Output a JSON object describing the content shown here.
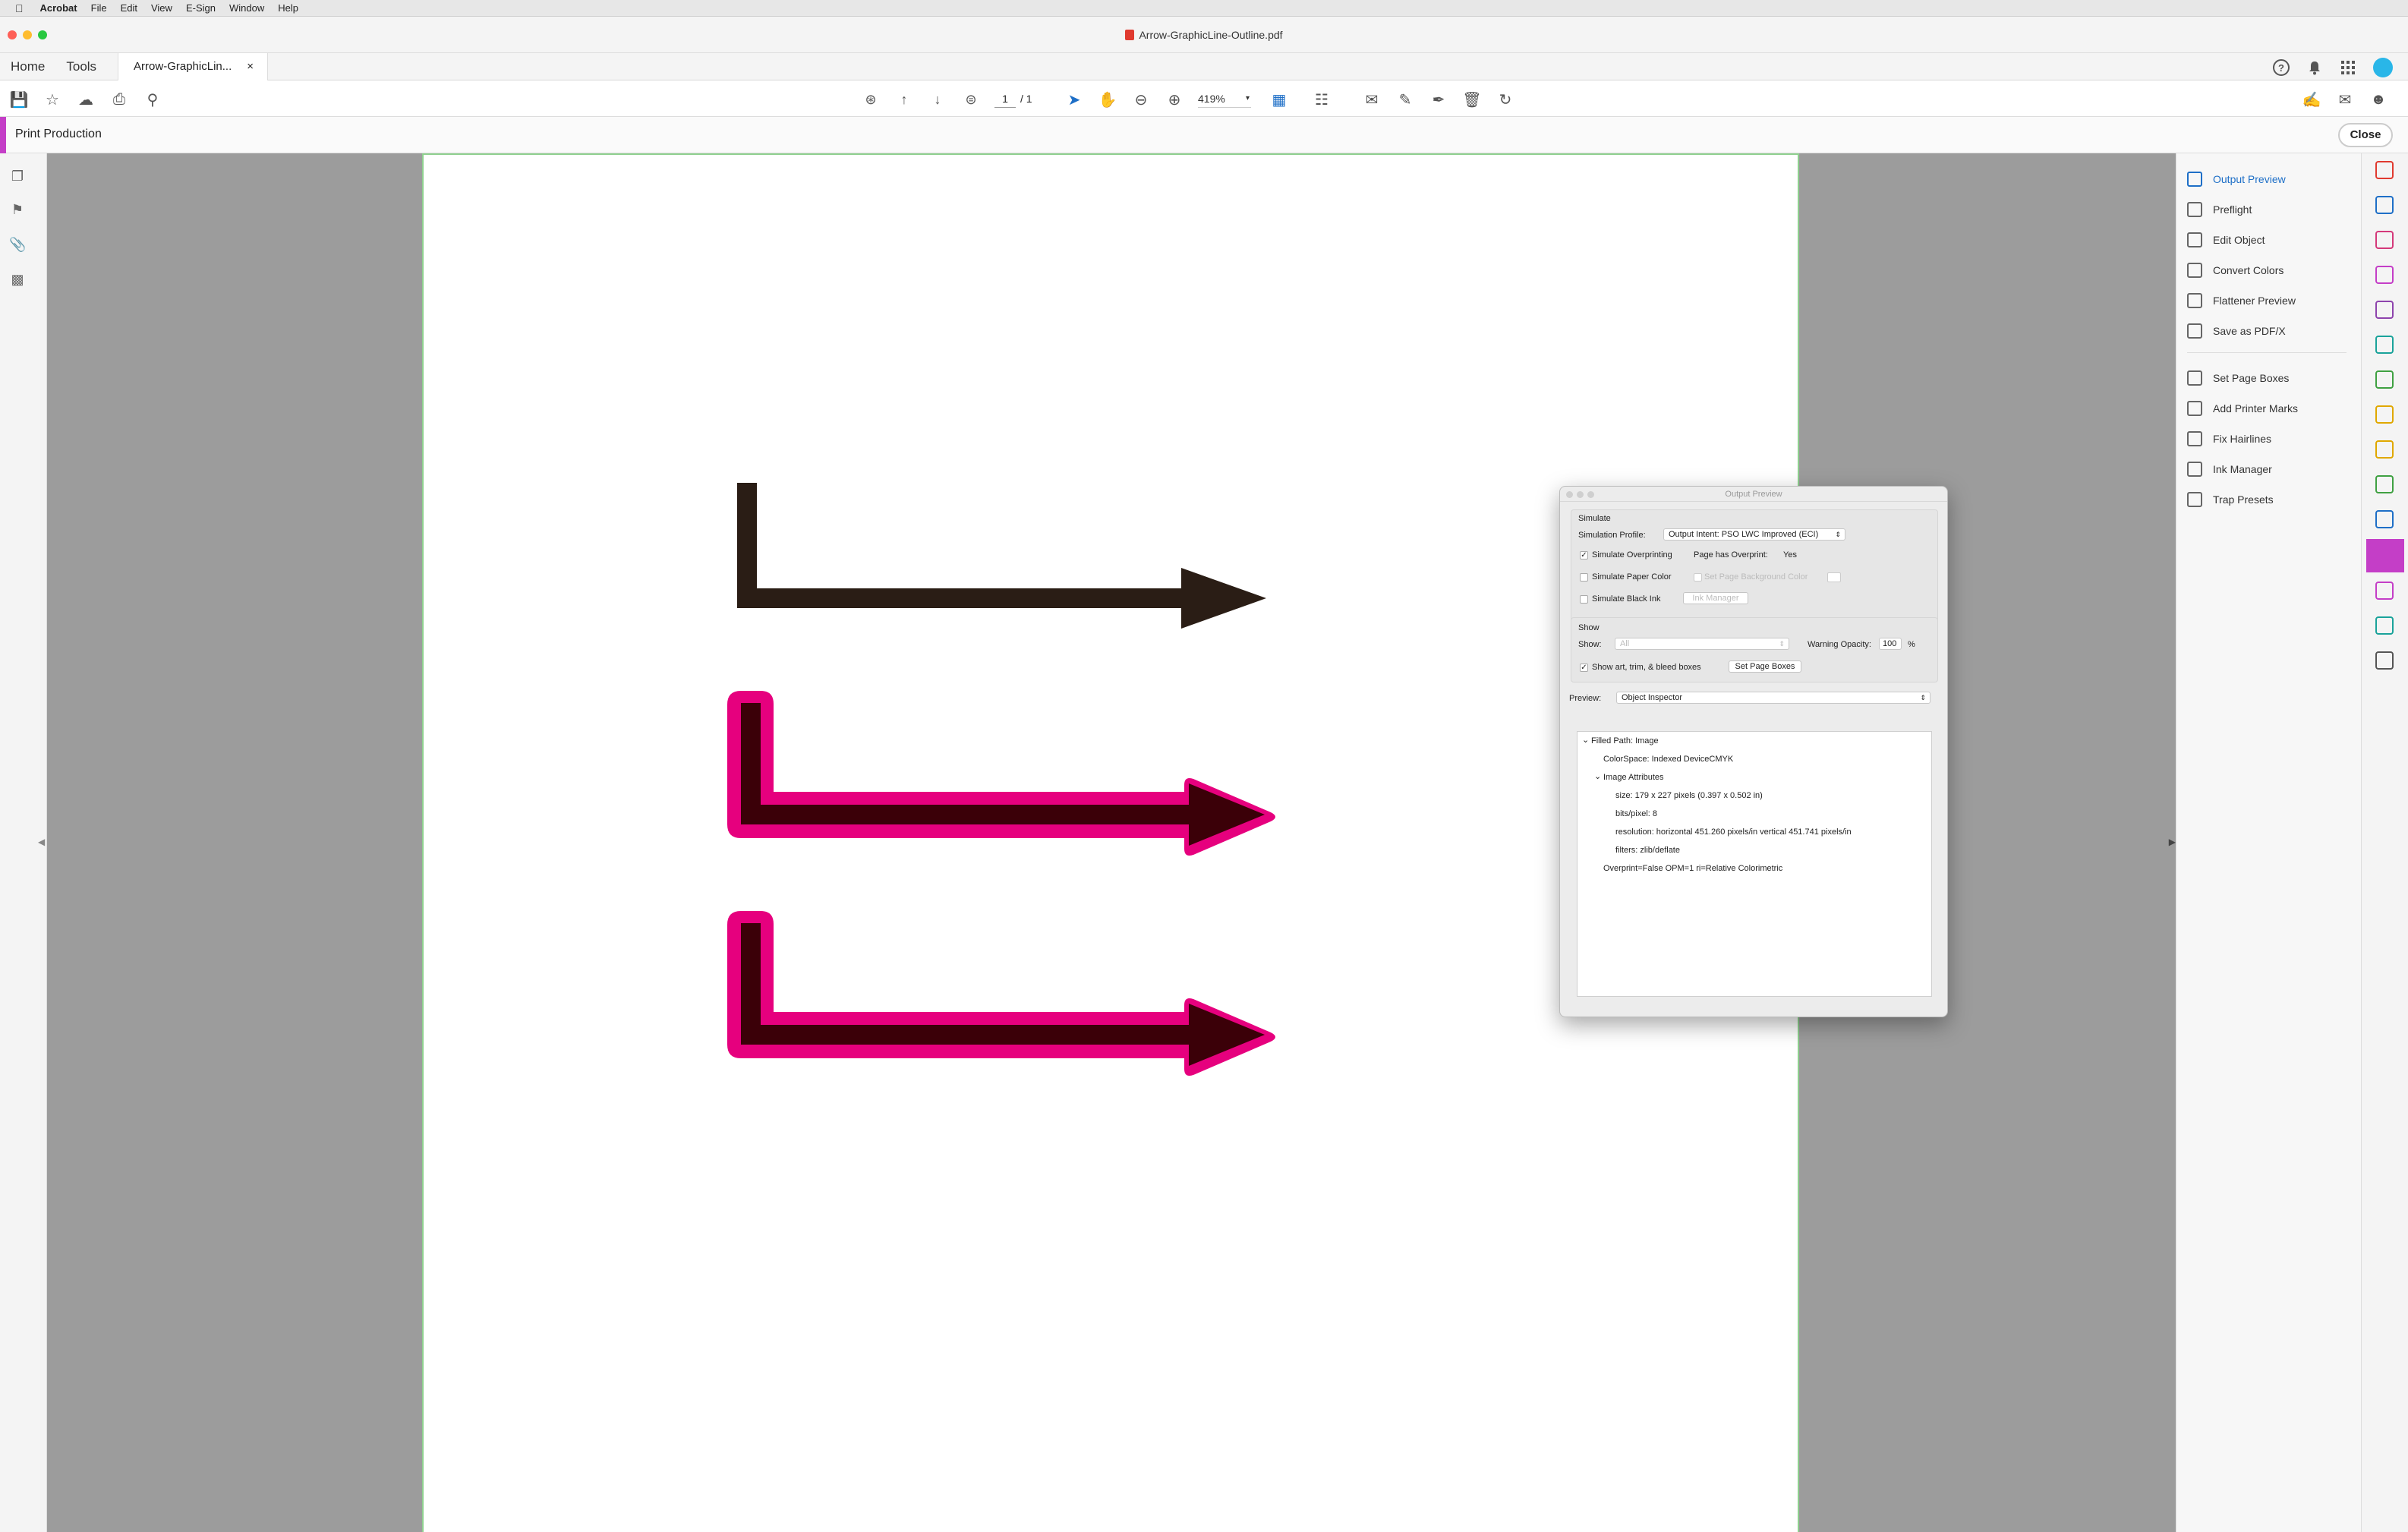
{
  "menubar": {
    "app": "Acrobat",
    "items": [
      "File",
      "Edit",
      "View",
      "E-Sign",
      "Window",
      "Help"
    ]
  },
  "window": {
    "title": "Arrow-GraphicLine-Outline.pdf"
  },
  "tabs": {
    "home": "Home",
    "tools": "Tools",
    "doc": "Arrow-GraphicLin...",
    "doc_close": "×"
  },
  "toolbar": {
    "page_current": "1",
    "page_total": "/ 1",
    "zoom": "419%"
  },
  "production_bar": {
    "title": "Print Production",
    "close": "Close"
  },
  "output_preview_dialog": {
    "title": "Output Preview",
    "simulate_header": "Simulate",
    "simulation_profile_label": "Simulation Profile:",
    "simulation_profile_value": "Output Intent: PSO LWC Improved (ECI)",
    "simulate_overprinting": "Simulate Overprinting",
    "simulate_overprinting_checked": true,
    "page_has_overprint_label": "Page has Overprint:",
    "page_has_overprint_value": "Yes",
    "simulate_paper_color": "Simulate Paper Color",
    "set_page_background_color": "Set Page Background Color",
    "simulate_black_ink": "Simulate Black Ink",
    "ink_manager": "Ink Manager",
    "show_header": "Show",
    "show_label": "Show:",
    "show_value": "All",
    "warning_opacity_label": "Warning Opacity:",
    "warning_opacity_value": "100",
    "percent": "%",
    "show_boxes": "Show art, trim, & bleed boxes",
    "show_boxes_checked": true,
    "set_page_boxes": "Set Page Boxes",
    "preview_label": "Preview:",
    "preview_value": "Object Inspector",
    "tree": {
      "filled_path": "Filled Path: Image",
      "colorspace": "ColorSpace: Indexed DeviceCMYK",
      "image_attributes": "Image Attributes",
      "size": "size: 179 x 227 pixels (0.397 x 0.502 in)",
      "bits": "bits/pixel: 8",
      "resolution": "resolution: horizontal 451.260 pixels/in vertical 451.741 pixels/in",
      "filters": "filters: zlib/deflate",
      "overprint": "Overprint=False OPM=1 ri=Relative Colorimetric"
    }
  },
  "right_panel": {
    "items": [
      "Output Preview",
      "Preflight",
      "Edit Object",
      "Convert Colors",
      "Flattener Preview",
      "Save as PDF/X",
      "Set Page Boxes",
      "Add Printer Marks",
      "Fix Hairlines",
      "Ink Manager",
      "Trap Presets"
    ]
  },
  "colors": {
    "accent": "#c43ec7",
    "arrow_dark": "#2a1d15",
    "highlight_magenta": "#e6007e",
    "arrow_fill_dark_red": "#3b0008"
  }
}
